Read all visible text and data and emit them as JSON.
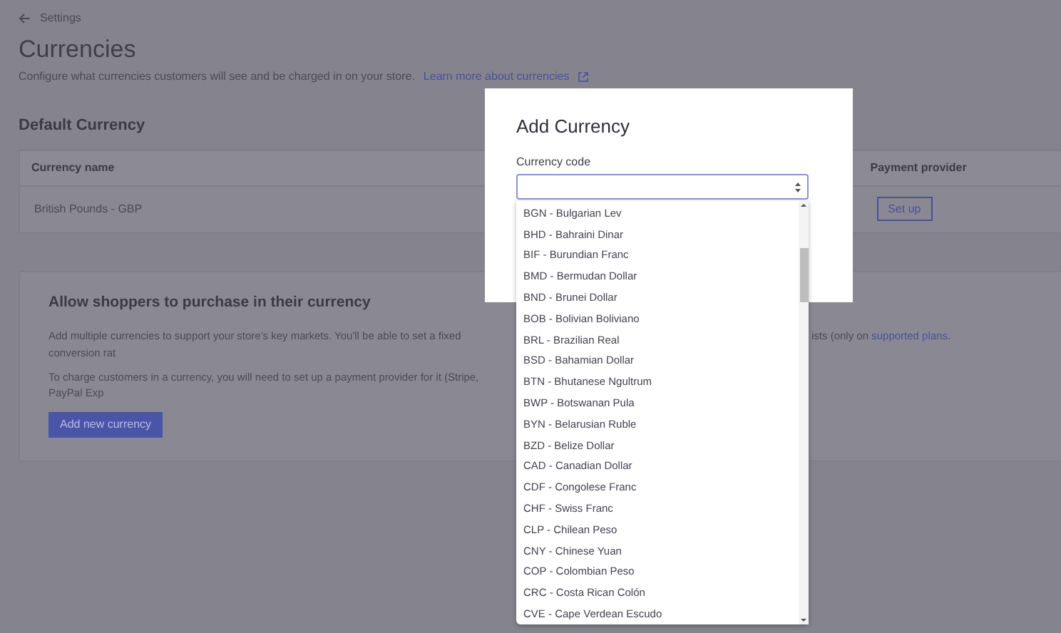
{
  "breadcrumb": {
    "label": "Settings"
  },
  "page": {
    "title": "Currencies",
    "subtitle": "Configure what currencies customers will see and be charged in on your store.",
    "learn_link": "Learn more about currencies"
  },
  "default_currency": {
    "heading": "Default Currency",
    "columns": [
      "Currency name",
      "Payment provider"
    ],
    "row": {
      "name": "British Pounds - GBP",
      "action": "Set up"
    }
  },
  "shoppers_card": {
    "title": "Allow shoppers to purchase in their currency",
    "paragraph_1_left": "Add multiple currencies to support your store's key markets. You'll be able to set a fixed conversion rat",
    "paragraph_1_right": "ists (only on ",
    "paragraph_1_link": "supported plans",
    "paragraph_1_end": ".",
    "paragraph_2_left": "To charge customers in a currency, you will need to set up a payment provider for it (Stripe, PayPal Exp",
    "button": "Add new currency"
  },
  "modal": {
    "title": "Add Currency",
    "field_label": "Currency code",
    "options": [
      "BGN - Bulgarian Lev",
      "BHD - Bahraini Dinar",
      "BIF - Burundian Franc",
      "BMD - Bermudan Dollar",
      "BND - Brunei Dollar",
      "BOB - Bolivian Boliviano",
      "BRL - Brazilian Real",
      "BSD - Bahamian Dollar",
      "BTN - Bhutanese Ngultrum",
      "BWP - Botswanan Pula",
      "BYN - Belarusian Ruble",
      "BZD - Belize Dollar",
      "CAD - Canadian Dollar",
      "CDF - Congolese Franc",
      "CHF - Swiss Franc",
      "CLP - Chilean Peso",
      "CNY - Chinese Yuan",
      "COP - Colombian Peso",
      "CRC - Costa Rican Colón",
      "CVE - Cape Verdean Escudo"
    ]
  }
}
